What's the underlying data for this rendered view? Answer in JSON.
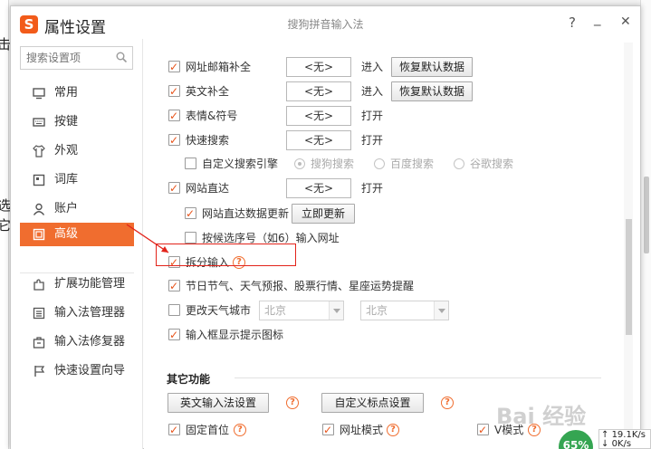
{
  "window": {
    "title": "属性设置",
    "subtitle": "搜狗拼音输入法",
    "help_label": "?",
    "close_label": "✕",
    "logo_letter": "S"
  },
  "background": {
    "left_char_1": "击",
    "left_char_2": "选",
    "left_char_3": "它"
  },
  "search": {
    "placeholder": "搜索设置项"
  },
  "sidebar": {
    "items": [
      {
        "label": "常用",
        "icon": "monitor-icon"
      },
      {
        "label": "按键",
        "icon": "keyboard-icon"
      },
      {
        "label": "外观",
        "icon": "shirt-icon"
      },
      {
        "label": "词库",
        "icon": "book-icon"
      },
      {
        "label": "账户",
        "icon": "user-icon"
      },
      {
        "label": "高级",
        "icon": "advanced-icon",
        "active": true
      }
    ],
    "lower_items": [
      {
        "label": "扩展功能管理",
        "icon": "puzzle-icon"
      },
      {
        "label": "输入法管理器",
        "icon": "list-icon"
      },
      {
        "label": "输入法修复器",
        "icon": "toolbox-icon"
      },
      {
        "label": "快速设置向导",
        "icon": "flag-icon"
      }
    ]
  },
  "settings": {
    "url_email": {
      "label": "网址邮箱补全",
      "checked": true,
      "hotkey": "<无>",
      "action": "进入",
      "reset": "恢复默认数据"
    },
    "english": {
      "label": "英文补全",
      "checked": true,
      "hotkey": "<无>",
      "action": "进入",
      "reset": "恢复默认数据"
    },
    "emoji": {
      "label": "表情&符号",
      "checked": true,
      "hotkey": "<无>",
      "action": "打开"
    },
    "quick_search": {
      "label": "快速搜索",
      "checked": true,
      "hotkey": "<无>",
      "action": "打开"
    },
    "custom_engine": {
      "label": "自定义搜索引擎",
      "checked": false,
      "options": [
        "搜狗搜索",
        "百度搜索",
        "谷歌搜索"
      ]
    },
    "site_direct": {
      "label": "网站直达",
      "checked": true,
      "hotkey": "<无>",
      "action": "打开"
    },
    "site_update": {
      "label": "网站直达数据更新",
      "checked": true,
      "button": "立即更新"
    },
    "candidate_url": {
      "label": "按候选序号（如6）输入网址",
      "checked": false
    },
    "split_input": {
      "label": "拆分输入",
      "checked": true
    },
    "festival": {
      "label": "节日节气、天气预报、股票行情、星座运势提醒",
      "checked": true
    },
    "weather_city": {
      "label": "更改天气城市",
      "checked": false,
      "province": "北京",
      "city": "北京"
    },
    "tray_icon": {
      "label": "输入框显示提示图标",
      "checked": true
    }
  },
  "other": {
    "title": "其它功能",
    "english_btn": "英文输入法设置",
    "punct_btn": "自定义标点设置",
    "fixed_first": {
      "label": "固定首位",
      "checked": true
    },
    "url_mode": {
      "label": "网址模式",
      "checked": true
    },
    "v_mode": {
      "label": "V模式",
      "checked": true
    }
  },
  "overlay": {
    "watermark": "Bai 经验",
    "battery_percent": "65%",
    "net_speed_up": "19.1K/s",
    "net_speed_down": "0K/s"
  },
  "colors": {
    "accent": "#f06d2f",
    "highlight_box": "#e2231a",
    "check": "#e8541b"
  }
}
